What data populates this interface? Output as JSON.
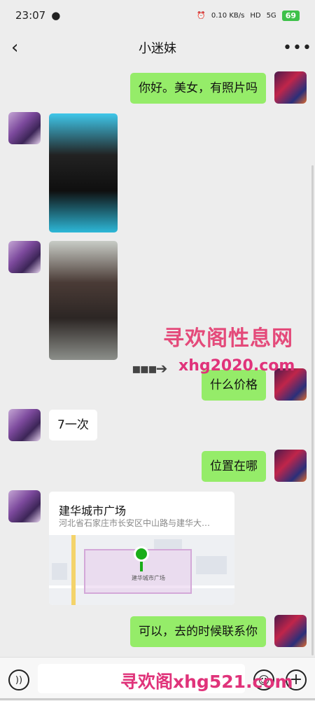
{
  "status_bar": {
    "time": "23:07",
    "chat_icon": "wechat-icon",
    "alarm_icon": "alarm-icon",
    "speed": "0.10 KB/s",
    "hd": "HD",
    "network": "5G",
    "battery": "69"
  },
  "header": {
    "back_icon": "chevron-left-icon",
    "title": "小迷妹",
    "more_icon": "more-icon"
  },
  "messages": [
    {
      "side": "right",
      "type": "text",
      "text": "你好。美女，有照片吗"
    },
    {
      "side": "left",
      "type": "image"
    },
    {
      "side": "left",
      "type": "image"
    },
    {
      "side": "right",
      "type": "text",
      "text": "什么价格"
    },
    {
      "side": "left",
      "type": "text",
      "text": "7一次"
    },
    {
      "side": "right",
      "type": "text",
      "text": "位置在哪"
    },
    {
      "side": "left",
      "type": "location",
      "title": "建华城市广场",
      "address": "河北省石家庄市长安区中山路与建华大…",
      "map_label": "建华城市广场"
    },
    {
      "side": "right",
      "type": "text",
      "text": "可以，去的时候联系你"
    }
  ],
  "watermarks": {
    "line1": "寻欢阁性息网",
    "line2": "xhg2020.com",
    "line3": "寻欢阁xhg521.com"
  },
  "input_bar": {
    "voice_icon": "voice-icon",
    "emoji_icon": "emoji-icon",
    "plus_icon": "plus-icon"
  },
  "colors": {
    "outgoing_bubble": "#95ec69",
    "incoming_bubble": "#ffffff",
    "background": "#ededed",
    "watermark": "#e0337a"
  }
}
